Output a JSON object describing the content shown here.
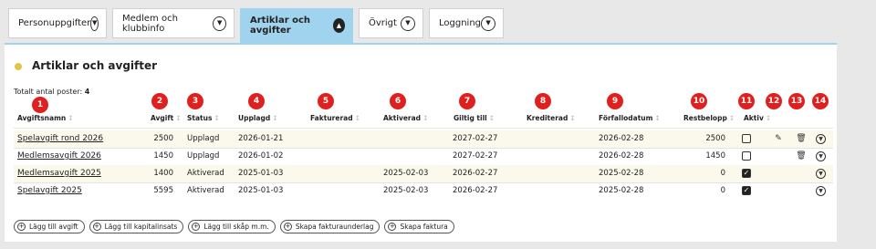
{
  "tabs": [
    {
      "label": "Personuppgifter"
    },
    {
      "label": "Medlem och klubbinfo"
    },
    {
      "label": "Artiklar och avgifter"
    },
    {
      "label": "Övrigt"
    },
    {
      "label": "Loggning"
    }
  ],
  "section": {
    "title": "Artiklar och avgifter",
    "total_label": "Totalt antal poster:",
    "total_value": "4"
  },
  "columns": [
    "Avgiftsnamn",
    "Avgift",
    "Status",
    "Upplagd",
    "Fakturerad",
    "Aktiverad",
    "Giltig till",
    "Krediterad",
    "Förfallodatum",
    "Restbelopp",
    "Aktiv"
  ],
  "badges": [
    "1",
    "2",
    "3",
    "4",
    "5",
    "6",
    "7",
    "8",
    "9",
    "10",
    "11",
    "12",
    "13",
    "14"
  ],
  "rows": [
    {
      "name": "Spelavgift rond 2026",
      "fee": "2500",
      "status": "Upplagd",
      "created": "2026-01-21",
      "invoiced": "",
      "activated": "",
      "valid_to": "2027-02-27",
      "credited": "",
      "due": "2026-02-28",
      "remaining": "2500",
      "active": false
    },
    {
      "name": "Medlemsavgift 2026",
      "fee": "1450",
      "status": "Upplagd",
      "created": "2026-01-02",
      "invoiced": "",
      "activated": "",
      "valid_to": "2027-02-27",
      "credited": "",
      "due": "2026-02-28",
      "remaining": "1450",
      "active": false
    },
    {
      "name": "Medlemsavgift 2025",
      "fee": "1400",
      "status": "Aktiverad",
      "created": "2025-01-03",
      "invoiced": "",
      "activated": "2025-02-03",
      "valid_to": "2026-02-27",
      "credited": "",
      "due": "2025-02-28",
      "remaining": "0",
      "active": true
    },
    {
      "name": "Spelavgift 2025",
      "fee": "5595",
      "status": "Aktiverad",
      "created": "2025-01-03",
      "invoiced": "",
      "activated": "2025-02-03",
      "valid_to": "2026-02-27",
      "credited": "",
      "due": "2025-02-28",
      "remaining": "0",
      "active": true
    }
  ],
  "actions": [
    {
      "label": "Lägg till avgift"
    },
    {
      "label": "Lägg till kapitalinsats"
    },
    {
      "label": "Lägg till skåp m.m."
    },
    {
      "label": "Skapa fakturaunderlag"
    },
    {
      "label": "Skapa faktura"
    }
  ],
  "colors": {
    "accent": "#9fd3ee",
    "badge": "#e0201f",
    "dot": "#e2c54a",
    "row_tint": "#fbf9ec"
  }
}
